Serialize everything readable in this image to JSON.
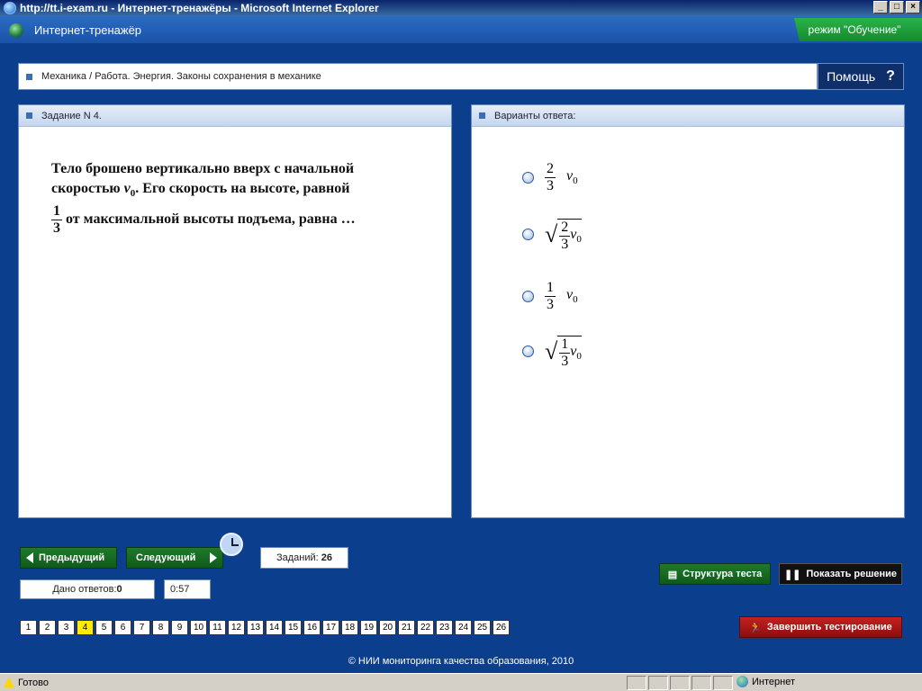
{
  "window": {
    "title": "http://tt.i-exam.ru - Интернет-тренажёры - Microsoft Internet Explorer"
  },
  "app": {
    "title": "Интернет-тренажёр",
    "mode": "режим \"Обучение\""
  },
  "breadcrumb": "Механика / Работа. Энергия. Законы сохранения в механике",
  "help_label": "Помощь",
  "task": {
    "header": "Задание N 4.",
    "text_part1": "Тело брошено вертикально вверх с начальной скоростью",
    "text_part2": ". Его скорость на высоте, равной",
    "text_part3": "от максимальной высоты подъема, равна …",
    "frac": {
      "num": "1",
      "den": "3"
    }
  },
  "answers": {
    "header": "Варианты ответа:",
    "options": [
      {
        "num": "2",
        "den": "3",
        "sqrt": false
      },
      {
        "num": "2",
        "den": "3",
        "sqrt": true
      },
      {
        "num": "1",
        "den": "3",
        "sqrt": false
      },
      {
        "num": "1",
        "den": "3",
        "sqrt": true
      }
    ]
  },
  "symbols": {
    "v": "v",
    "sub": "0"
  },
  "nav": {
    "prev": "Предыдущий",
    "next": "Следующий"
  },
  "tasks_count": {
    "label": "Заданий:",
    "value": "26"
  },
  "answered": {
    "label": "Дано ответов:",
    "value": "0"
  },
  "timer": "0:57",
  "pages": [
    "1",
    "2",
    "3",
    "4",
    "5",
    "6",
    "7",
    "8",
    "9",
    "10",
    "11",
    "12",
    "13",
    "14",
    "15",
    "16",
    "17",
    "18",
    "19",
    "20",
    "21",
    "22",
    "23",
    "24",
    "25",
    "26"
  ],
  "active_page": "4",
  "buttons": {
    "structure": "Структура теста",
    "solution": "Показать решение",
    "finish": "Завершить тестирование"
  },
  "footer": "© НИИ мониторинга качества образования, 2010",
  "status": {
    "text": "Готово",
    "zone": "Интернет"
  }
}
